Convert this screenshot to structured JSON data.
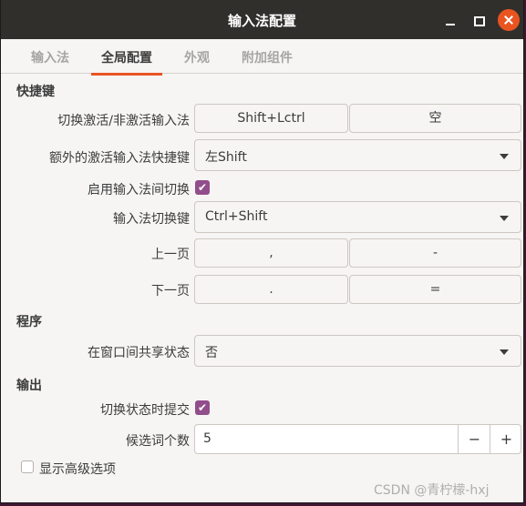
{
  "window": {
    "title": "输入法配置"
  },
  "tabs": [
    {
      "label": "输入法"
    },
    {
      "label": "全局配置"
    },
    {
      "label": "外观"
    },
    {
      "label": "附加组件"
    }
  ],
  "sections": {
    "hotkeys": "快捷键",
    "program": "程序",
    "output": "输出"
  },
  "hotkeys": {
    "toggle_label": "切换激活/非激活输入法",
    "toggle_key1": "Shift+Lctrl",
    "toggle_key2": "空",
    "extra_label": "额外的激活输入法快捷键",
    "extra_value": "左Shift",
    "enable_switch_label": "启用输入法间切换",
    "enable_switch_checked": true,
    "switch_key_label": "输入法切换键",
    "switch_key_value": "Ctrl+Shift",
    "prev_page_label": "上一页",
    "prev_page_key1": ",",
    "prev_page_key2": "-",
    "next_page_label": "下一页",
    "next_page_key1": ".",
    "next_page_key2": "="
  },
  "program": {
    "share_state_label": "在窗口间共享状态",
    "share_state_value": "否"
  },
  "output": {
    "commit_on_switch_label": "切换状态时提交",
    "commit_on_switch_checked": true,
    "candidate_count_label": "候选词个数",
    "candidate_count_value": "5",
    "minus": "−",
    "plus": "+"
  },
  "advanced": {
    "label": "显示高级选项",
    "checked": false
  },
  "check_glyph": "✔",
  "watermark": "CSDN @青柠檬-hxj",
  "colors": {
    "titlebar": "#302f2c",
    "accent": "#e95420",
    "checkbox": "#924d8b",
    "window_bg": "#f6f5f4",
    "desktop_bg": "#3b1830"
  }
}
